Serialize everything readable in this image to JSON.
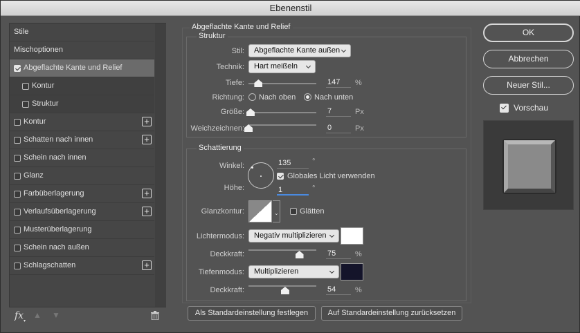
{
  "window": {
    "title": "Ebenenstil"
  },
  "sidebar": {
    "items": [
      {
        "label": "Stile",
        "checkbox": false,
        "checked": false,
        "plus": false,
        "selected": false,
        "sub": false
      },
      {
        "label": "Mischoptionen",
        "checkbox": false,
        "checked": false,
        "plus": false,
        "selected": false,
        "sub": false
      },
      {
        "label": "Abgeflachte Kante und Relief",
        "checkbox": true,
        "checked": true,
        "plus": false,
        "selected": true,
        "sub": false
      },
      {
        "label": "Kontur",
        "checkbox": true,
        "checked": false,
        "plus": false,
        "selected": false,
        "sub": true
      },
      {
        "label": "Struktur",
        "checkbox": true,
        "checked": false,
        "plus": false,
        "selected": false,
        "sub": true
      },
      {
        "label": "Kontur",
        "checkbox": true,
        "checked": false,
        "plus": true,
        "selected": false,
        "sub": false
      },
      {
        "label": "Schatten nach innen",
        "checkbox": true,
        "checked": false,
        "plus": true,
        "selected": false,
        "sub": false
      },
      {
        "label": "Schein nach innen",
        "checkbox": true,
        "checked": false,
        "plus": false,
        "selected": false,
        "sub": false
      },
      {
        "label": "Glanz",
        "checkbox": true,
        "checked": false,
        "plus": false,
        "selected": false,
        "sub": false
      },
      {
        "label": "Farbüberlagerung",
        "checkbox": true,
        "checked": false,
        "plus": true,
        "selected": false,
        "sub": false
      },
      {
        "label": "Verlaufsüberlagerung",
        "checkbox": true,
        "checked": false,
        "plus": true,
        "selected": false,
        "sub": false
      },
      {
        "label": "Musterüberlagerung",
        "checkbox": true,
        "checked": false,
        "plus": false,
        "selected": false,
        "sub": false
      },
      {
        "label": "Schein nach außen",
        "checkbox": true,
        "checked": false,
        "plus": false,
        "selected": false,
        "sub": false
      },
      {
        "label": "Schlagschatten",
        "checkbox": true,
        "checked": false,
        "plus": true,
        "selected": false,
        "sub": false
      }
    ],
    "fx_label": "fx"
  },
  "main": {
    "section_title": "Abgeflachte Kante und Relief",
    "structure": {
      "title": "Struktur",
      "stil_label": "Stil:",
      "stil_value": "Abgeflachte Kante außen",
      "technik_label": "Technik:",
      "technik_value": "Hart meißeln",
      "tiefe_label": "Tiefe:",
      "tiefe_value": "147",
      "tiefe_unit": "%",
      "tiefe_level": 0.147,
      "richtung_label": "Richtung:",
      "up_label": "Nach oben",
      "down_label": "Nach unten",
      "direction": "down",
      "groesse_label": "Größe:",
      "groesse_value": "7",
      "groesse_unit": "Px",
      "groesse_level": 0.03,
      "weich_label": "Weichzeichnen:",
      "weich_value": "0",
      "weich_unit": "Px",
      "weich_level": 0.0
    },
    "shading": {
      "title": "Schattierung",
      "winkel_label": "Winkel:",
      "winkel_value": "135",
      "deg": "°",
      "global_label": "Globales Licht verwenden",
      "global_checked": true,
      "hoehe_label": "Höhe:",
      "hoehe_value": "1",
      "glanz_label": "Glanzkontur:",
      "glaetten_label": "Glätten",
      "glaetten_checked": false,
      "licht_label": "Lichtermodus:",
      "licht_value": "Negativ multiplizieren",
      "licht_color": "#ffffff",
      "deck1_label": "Deckkraft:",
      "deck1_value": "75",
      "deck1_unit": "%",
      "deck1_level": 0.75,
      "tiefen_label": "Tiefenmodus:",
      "tiefen_value": "Multiplizieren",
      "tiefen_color": "#14142a",
      "deck2_label": "Deckkraft:",
      "deck2_value": "54",
      "deck2_unit": "%",
      "deck2_level": 0.54
    },
    "default_btn": "Als Standardeinstellung festlegen",
    "reset_btn": "Auf Standardeinstellung zurücksetzen"
  },
  "right": {
    "ok": "OK",
    "cancel": "Abbrechen",
    "new_style": "Neuer Stil...",
    "preview_label": "Vorschau",
    "preview_checked": true
  }
}
